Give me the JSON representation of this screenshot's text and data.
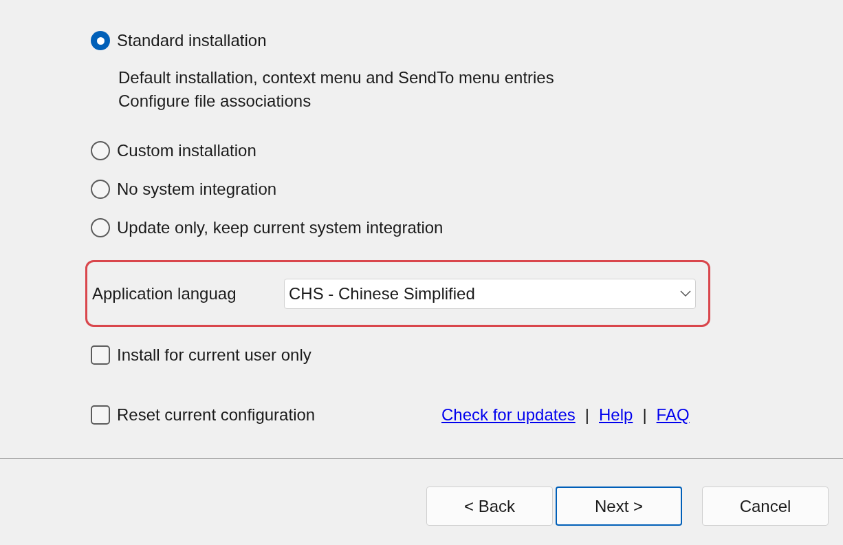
{
  "install_options": [
    {
      "label": "Standard installation",
      "selected": true,
      "description": [
        "Default installation, context menu and SendTo menu entries",
        "Configure file associations"
      ]
    },
    {
      "label": "Custom installation",
      "selected": false
    },
    {
      "label": "No system integration",
      "selected": false
    },
    {
      "label": "Update only, keep current system integration",
      "selected": false
    }
  ],
  "language": {
    "label": "Application languag",
    "value": "CHS - Chinese Simplified",
    "highlighted": true
  },
  "checkboxes": [
    {
      "label": "Install for current user only",
      "checked": false
    },
    {
      "label": "Reset current configuration",
      "checked": false
    }
  ],
  "links": [
    {
      "label": "Check for updates"
    },
    {
      "label": "Help"
    },
    {
      "label": "FAQ"
    }
  ],
  "link_separator": "|",
  "buttons": [
    {
      "label": "< Back",
      "default": false
    },
    {
      "label": "Next >",
      "default": true
    },
    {
      "label": "Cancel",
      "default": false
    }
  ]
}
